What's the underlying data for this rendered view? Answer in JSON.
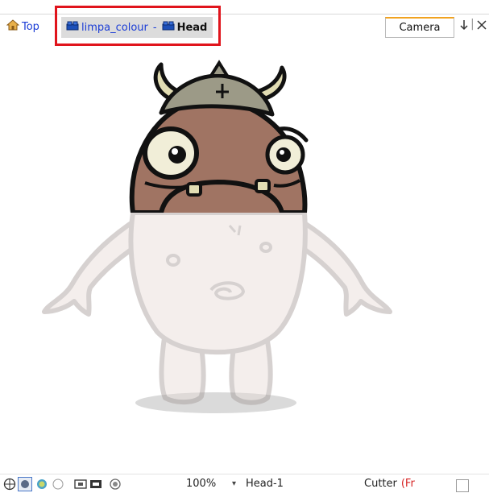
{
  "breadcrumb": {
    "top_label": "Top",
    "group_label": "limpa_colour",
    "separator": "-",
    "current_label": "Head"
  },
  "view_tab": {
    "label": "Camera"
  },
  "tab_controls": {
    "pin_icon": "pin-icon",
    "close_icon": "close-icon"
  },
  "bottom_toolbar": {
    "zoom": "100%",
    "node_name": "Head-1",
    "cutter_label": "Cutter",
    "cutter_suffix": "(Fr",
    "icons": [
      "crosshair-icon",
      "render-mode-icon",
      "gear-icon",
      "light-table-icon",
      "safe-area-icon",
      "frame-icon",
      "onion-skin-icon"
    ]
  },
  "colors": {
    "link_blue": "#1a3cd6",
    "highlight_red": "#e0141c",
    "tab_accent": "#f1a21f",
    "faded_body": "#e8dcd8",
    "head_brown": "#a07463"
  }
}
